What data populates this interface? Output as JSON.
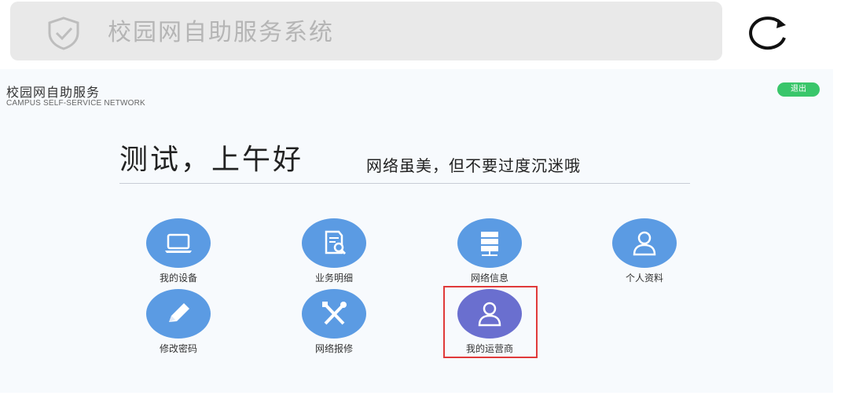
{
  "search": {
    "title": "校园网自助服务系统"
  },
  "brand": {
    "title": "校园网自助服务",
    "subtitle": "CAMPUS  SELF-SERVICE NETWORK"
  },
  "logout_label": "退出",
  "greeting": "测试，上午好",
  "motto": "网络虽美，但不要过度沉迷哦",
  "tiles": [
    {
      "label": "我的设备",
      "icon": "laptop-icon"
    },
    {
      "label": "业务明细",
      "icon": "document-search-icon"
    },
    {
      "label": "网络信息",
      "icon": "server-icon"
    },
    {
      "label": "个人资料",
      "icon": "user-icon"
    },
    {
      "label": "修改密码",
      "icon": "pencil-icon"
    },
    {
      "label": "网络报修",
      "icon": "tools-icon"
    },
    {
      "label": "我的运营商",
      "icon": "user-icon"
    }
  ],
  "colors": {
    "tile_blue": "#5b9be3",
    "tile_purple": "#6a6fcf",
    "logout_green": "#39c66a",
    "highlight_red": "#e03a3a"
  }
}
